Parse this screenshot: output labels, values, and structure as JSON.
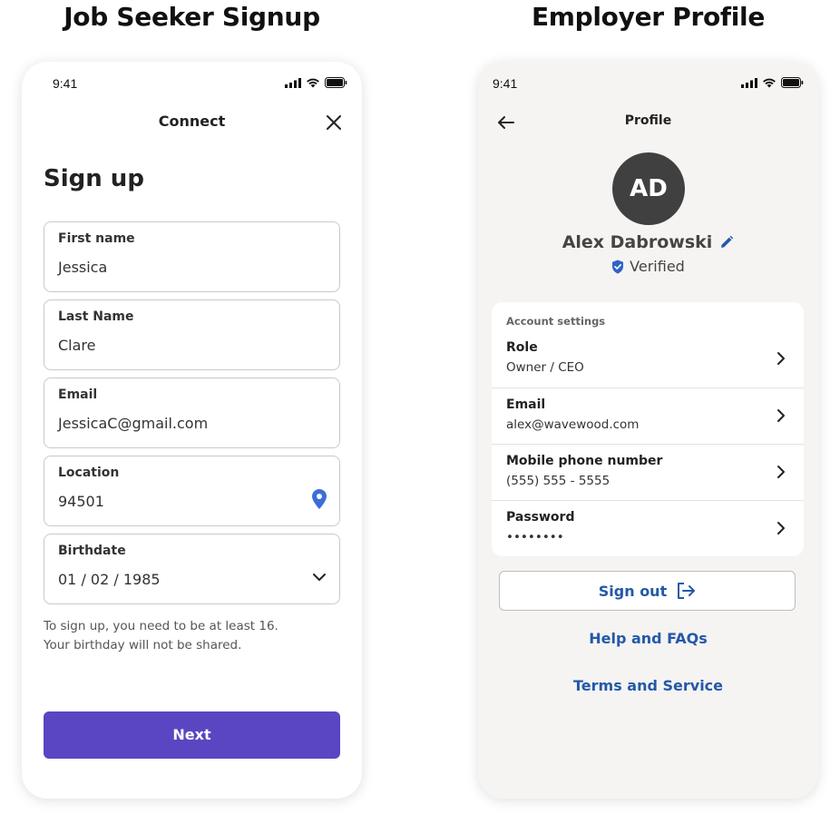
{
  "headings": {
    "left": "Job Seeker Signup",
    "right": "Employer Profile"
  },
  "signup_screen": {
    "status_time": "9:41",
    "topbar_title": "Connect",
    "page_title": "Sign up",
    "fields": [
      {
        "label": "First name",
        "value": "Jessica"
      },
      {
        "label": "Last Name",
        "value": "Clare"
      },
      {
        "label": "Email",
        "value": "JessicaC@gmail.com"
      },
      {
        "label": "Location",
        "value": "94501",
        "icon": "location-pin-icon"
      },
      {
        "label": "Birthdate",
        "value": "01 / 02 / 1985",
        "icon": "chevron-down-icon"
      }
    ],
    "hint_line1": "To sign up, you need to be at least 16.",
    "hint_line2": "Your birthday will not be shared.",
    "next_label": "Next",
    "colors": {
      "primary": "#5a46c2",
      "pin": "#3b6fd8"
    }
  },
  "profile_screen": {
    "status_time": "9:41",
    "topbar_title": "Profile",
    "avatar_initials": "AD",
    "name": "Alex Dabrowski",
    "verified_label": "Verified",
    "section_label": "Account settings",
    "rows": [
      {
        "label": "Role",
        "value": "Owner / CEO"
      },
      {
        "label": "Email",
        "value": "alex@wavewood.com"
      },
      {
        "label": "Mobile phone number",
        "value": "(555) 555 - 5555"
      },
      {
        "label": "Password",
        "value": "••••••••"
      }
    ],
    "sign_out_label": "Sign out",
    "help_label": "Help and FAQs",
    "terms_label": "Terms and Service",
    "colors": {
      "link": "#2359a8",
      "avatar": "#404040",
      "background": "#f6f4f2"
    }
  }
}
